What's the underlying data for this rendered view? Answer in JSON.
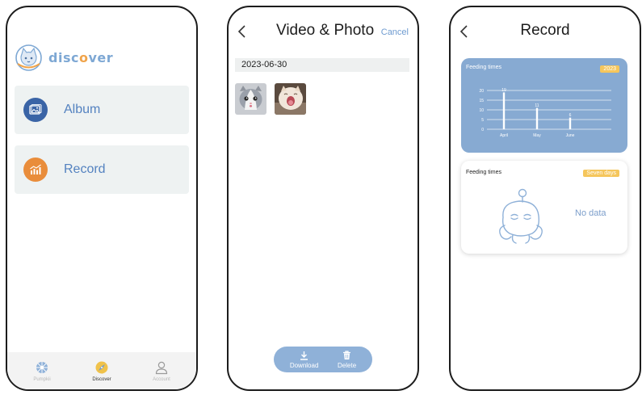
{
  "discover": {
    "brand_prefix": "disc",
    "brand_o": "o",
    "brand_suffix": "ver",
    "cards": [
      {
        "label": "Album",
        "icon": "photo-album-icon",
        "color": "#3a64a6"
      },
      {
        "label": "Record",
        "icon": "bar-chart-icon",
        "color": "#e98d3b"
      }
    ],
    "tabs": [
      {
        "label": "Pumpkii",
        "icon": "pumpkii-icon",
        "active": false
      },
      {
        "label": "Discover",
        "icon": "discover-icon",
        "active": true
      },
      {
        "label": "Account",
        "icon": "account-icon",
        "active": false
      }
    ]
  },
  "video_photo": {
    "title": "Video & Photo",
    "cancel_label": "Cancel",
    "date": "2023-06-30",
    "thumbnails": [
      "kitten-photo",
      "yawning-kitten-photo"
    ],
    "download_label": "Download",
    "delete_label": "Delete"
  },
  "record": {
    "title": "Record",
    "chart_card": {
      "title": "Feeding times",
      "badge": "2023"
    },
    "feed_card": {
      "title": "Feeding times",
      "badge": "Seven days",
      "empty_text": "No data"
    }
  },
  "chart_data": {
    "type": "bar",
    "title": "Feeding times",
    "categories": [
      "April",
      "May",
      "June"
    ],
    "values": [
      19,
      11,
      6
    ],
    "ylim": [
      0,
      20
    ],
    "yticks": [
      0,
      5,
      10,
      15,
      20
    ],
    "grid": true
  },
  "colors": {
    "accent_blue": "#87aad2",
    "badge_yellow": "#f5c65c",
    "record_orange": "#e98d3b",
    "album_blue": "#3a64a6"
  }
}
